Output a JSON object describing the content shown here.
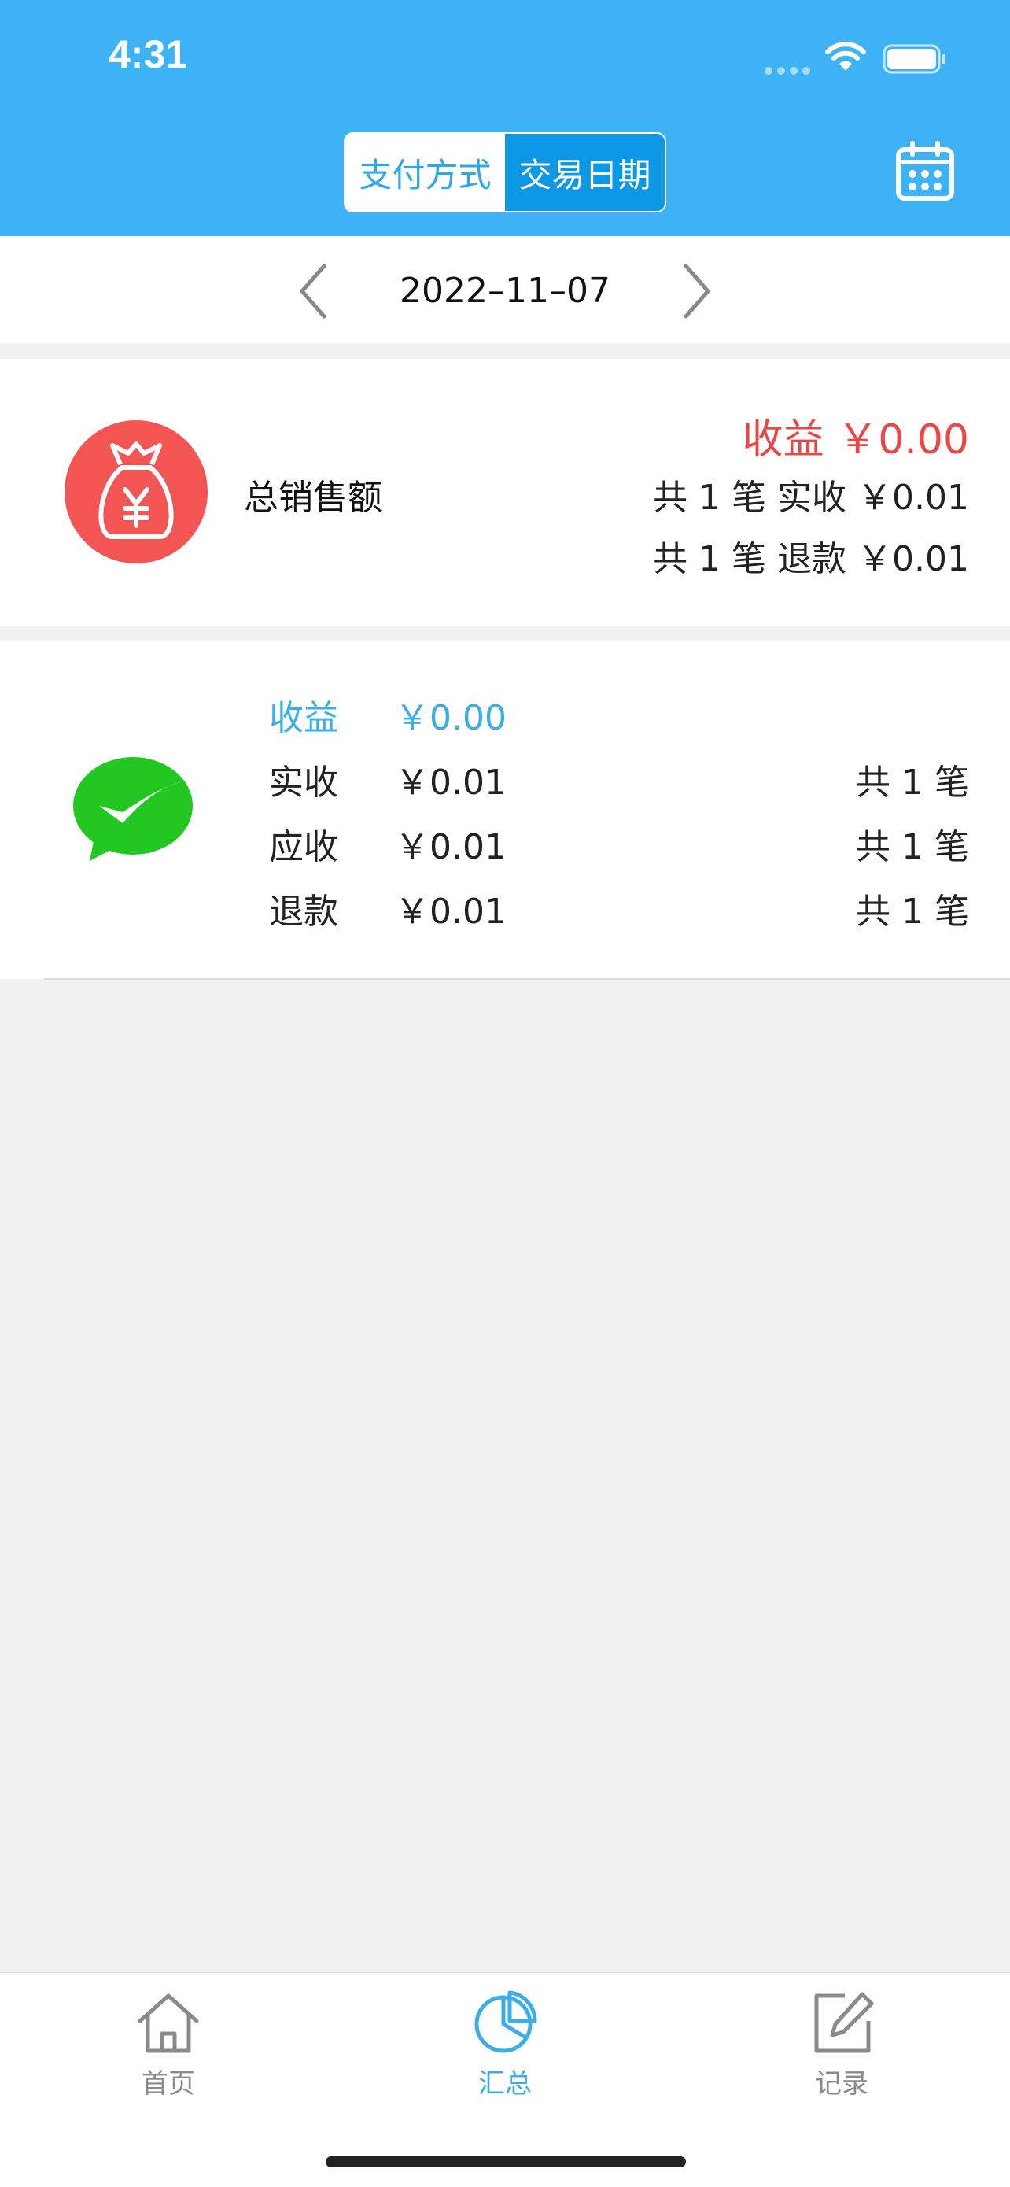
{
  "status_bar": {
    "time": "4:31"
  },
  "header": {
    "segments": [
      "支付方式",
      "交易日期"
    ],
    "selected_segment": "交易日期",
    "icons": {
      "calendar": "calendar-icon"
    },
    "colors": {
      "background": "#3db3f5",
      "active_segment": "#0b98e6"
    }
  },
  "date_nav": {
    "date": "2022–11–07"
  },
  "total": {
    "label": "总销售额",
    "profit": "收益 ￥0.00",
    "received_line": "共 1 笔 实收 ￥0.01",
    "refund_line": "共 1 笔 退款 ￥0.01",
    "colors": {
      "profit": "#ee4646",
      "icon_bg": "#f35555"
    }
  },
  "wechat": {
    "rows": [
      {
        "label": "收益",
        "amount": "￥0.00"
      },
      {
        "label": "实收",
        "amount": "￥0.01",
        "count": "共 1 笔"
      },
      {
        "label": "应收",
        "amount": "￥0.01",
        "count": "共 1 笔"
      },
      {
        "label": "退款",
        "amount": "￥0.01",
        "count": "共 1 笔"
      }
    ],
    "colors": {
      "profit": "#3aaee8",
      "icon": "#22c722"
    }
  },
  "tab_bar": {
    "tabs": [
      {
        "label": "首页",
        "icon": "home-icon"
      },
      {
        "label": "汇总",
        "icon": "pie-chart-icon",
        "active": true
      },
      {
        "label": "记录",
        "icon": "edit-icon"
      }
    ],
    "colors": {
      "active": "#3aaee8",
      "inactive": "#8a8a8a"
    }
  }
}
